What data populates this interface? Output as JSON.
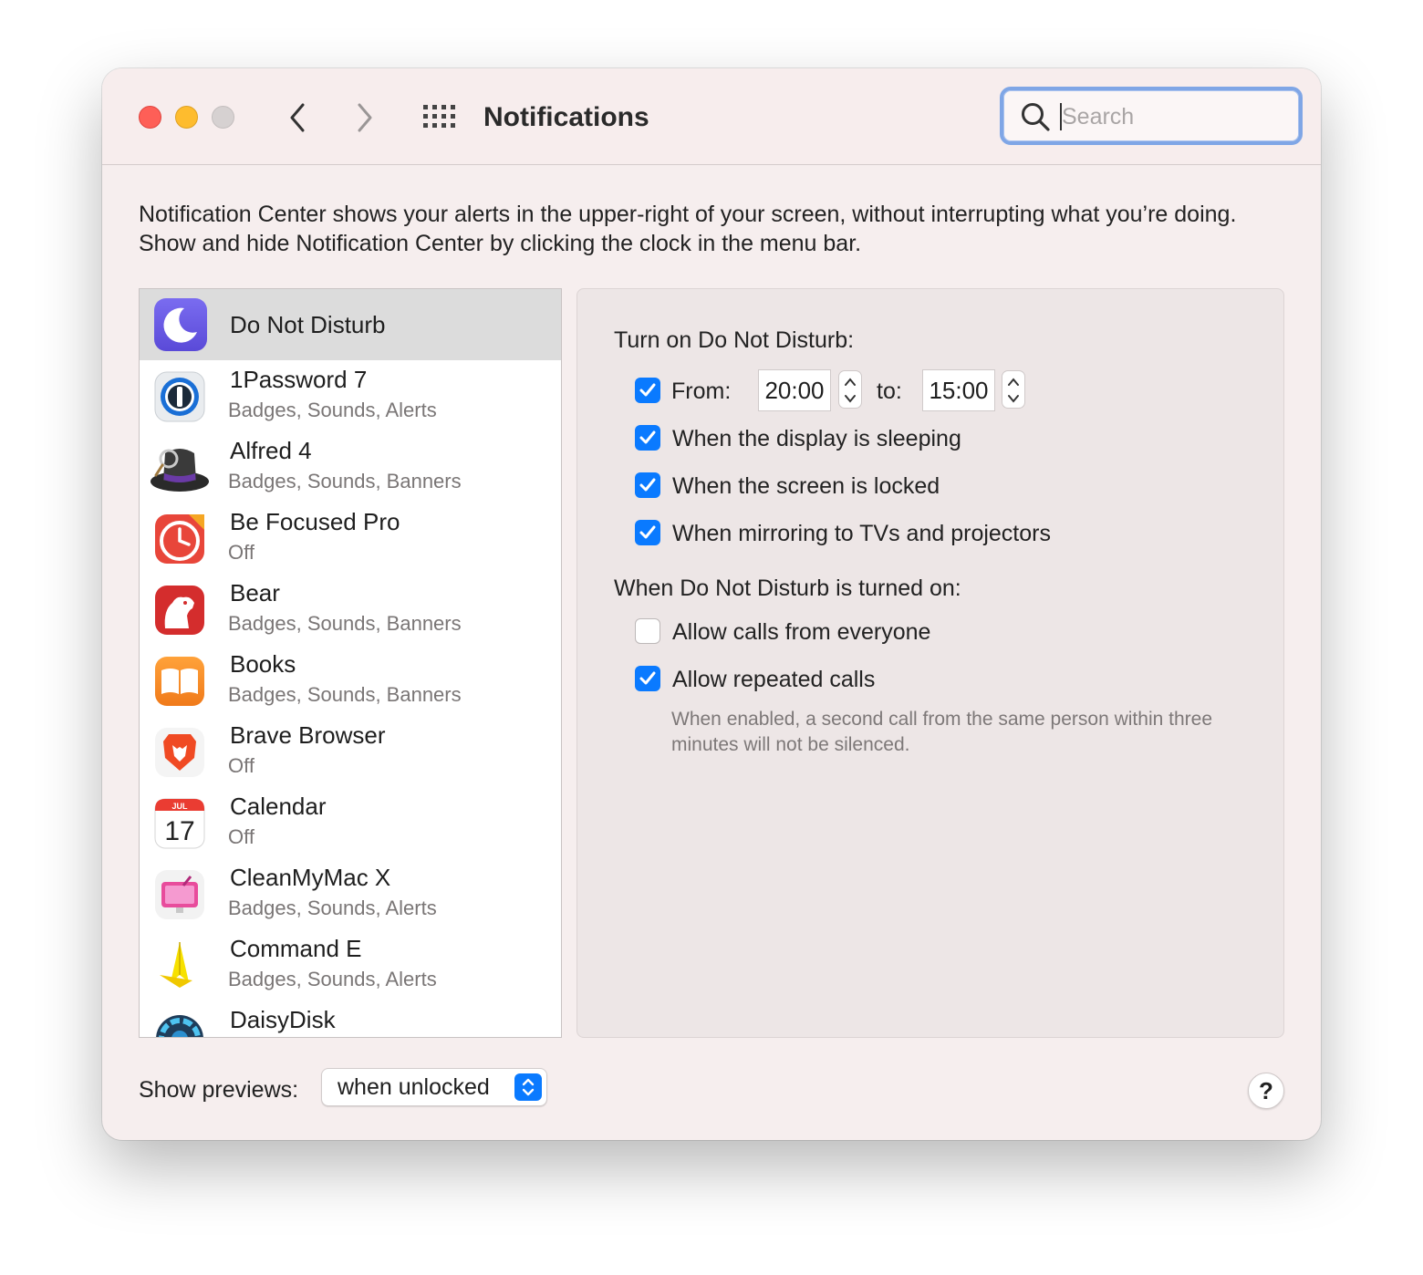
{
  "window": {
    "title": "Notifications"
  },
  "search": {
    "placeholder": "Search"
  },
  "description": "Notification Center shows your alerts in the upper-right of your screen, without interrupting what you’re doing. Show and hide Notification Center by clicking the clock in the menu bar.",
  "apps": [
    {
      "name": "Do Not Disturb",
      "sub": "",
      "icon": "moon-icon",
      "selected": true
    },
    {
      "name": "1Password 7",
      "sub": "Badges, Sounds, Alerts",
      "icon": "1password-icon"
    },
    {
      "name": "Alfred 4",
      "sub": "Badges, Sounds, Banners",
      "icon": "alfred-hat-icon"
    },
    {
      "name": "Be Focused Pro",
      "sub": "Off",
      "icon": "timer-icon"
    },
    {
      "name": "Bear",
      "sub": "Badges, Sounds, Banners",
      "icon": "bear-icon"
    },
    {
      "name": "Books",
      "sub": "Badges, Sounds, Banners",
      "icon": "book-icon"
    },
    {
      "name": "Brave Browser",
      "sub": "Off",
      "icon": "brave-lion-icon"
    },
    {
      "name": "Calendar",
      "sub": "Off",
      "icon": "calendar-icon",
      "month": "JUL",
      "day": "17"
    },
    {
      "name": "CleanMyMac X",
      "sub": "Badges, Sounds, Alerts",
      "icon": "cleanmymac-icon"
    },
    {
      "name": "Command E",
      "sub": "Badges, Sounds, Alerts",
      "icon": "command-e-icon"
    },
    {
      "name": "DaisyDisk",
      "sub": "",
      "icon": "daisydisk-icon"
    }
  ],
  "dnd": {
    "turn_on_label": "Turn on Do Not Disturb:",
    "from_label": "From:",
    "from_time": "20:00",
    "to_label": "to:",
    "to_time": "15:00",
    "from_checked": true,
    "display_sleeping": {
      "label": "When the display is sleeping",
      "checked": true
    },
    "screen_locked": {
      "label": "When the screen is locked",
      "checked": true
    },
    "mirroring": {
      "label": "When mirroring to TVs and projectors",
      "checked": true
    },
    "when_on_label": "When Do Not Disturb is turned on:",
    "allow_everyone": {
      "label": "Allow calls from everyone",
      "checked": false
    },
    "allow_repeated": {
      "label": "Allow repeated calls",
      "checked": true
    },
    "note": "When enabled, a second call from the same person within three minutes will not be silenced."
  },
  "previews": {
    "label": "Show previews:",
    "value": "when unlocked"
  },
  "help_label": "?",
  "colors": {
    "accent": "#0a7aff",
    "window_bg": "#f6eeee",
    "panel_bg": "#ede6e6",
    "selected_row": "#dcdcdc",
    "search_focus": "#7fa6e6"
  }
}
